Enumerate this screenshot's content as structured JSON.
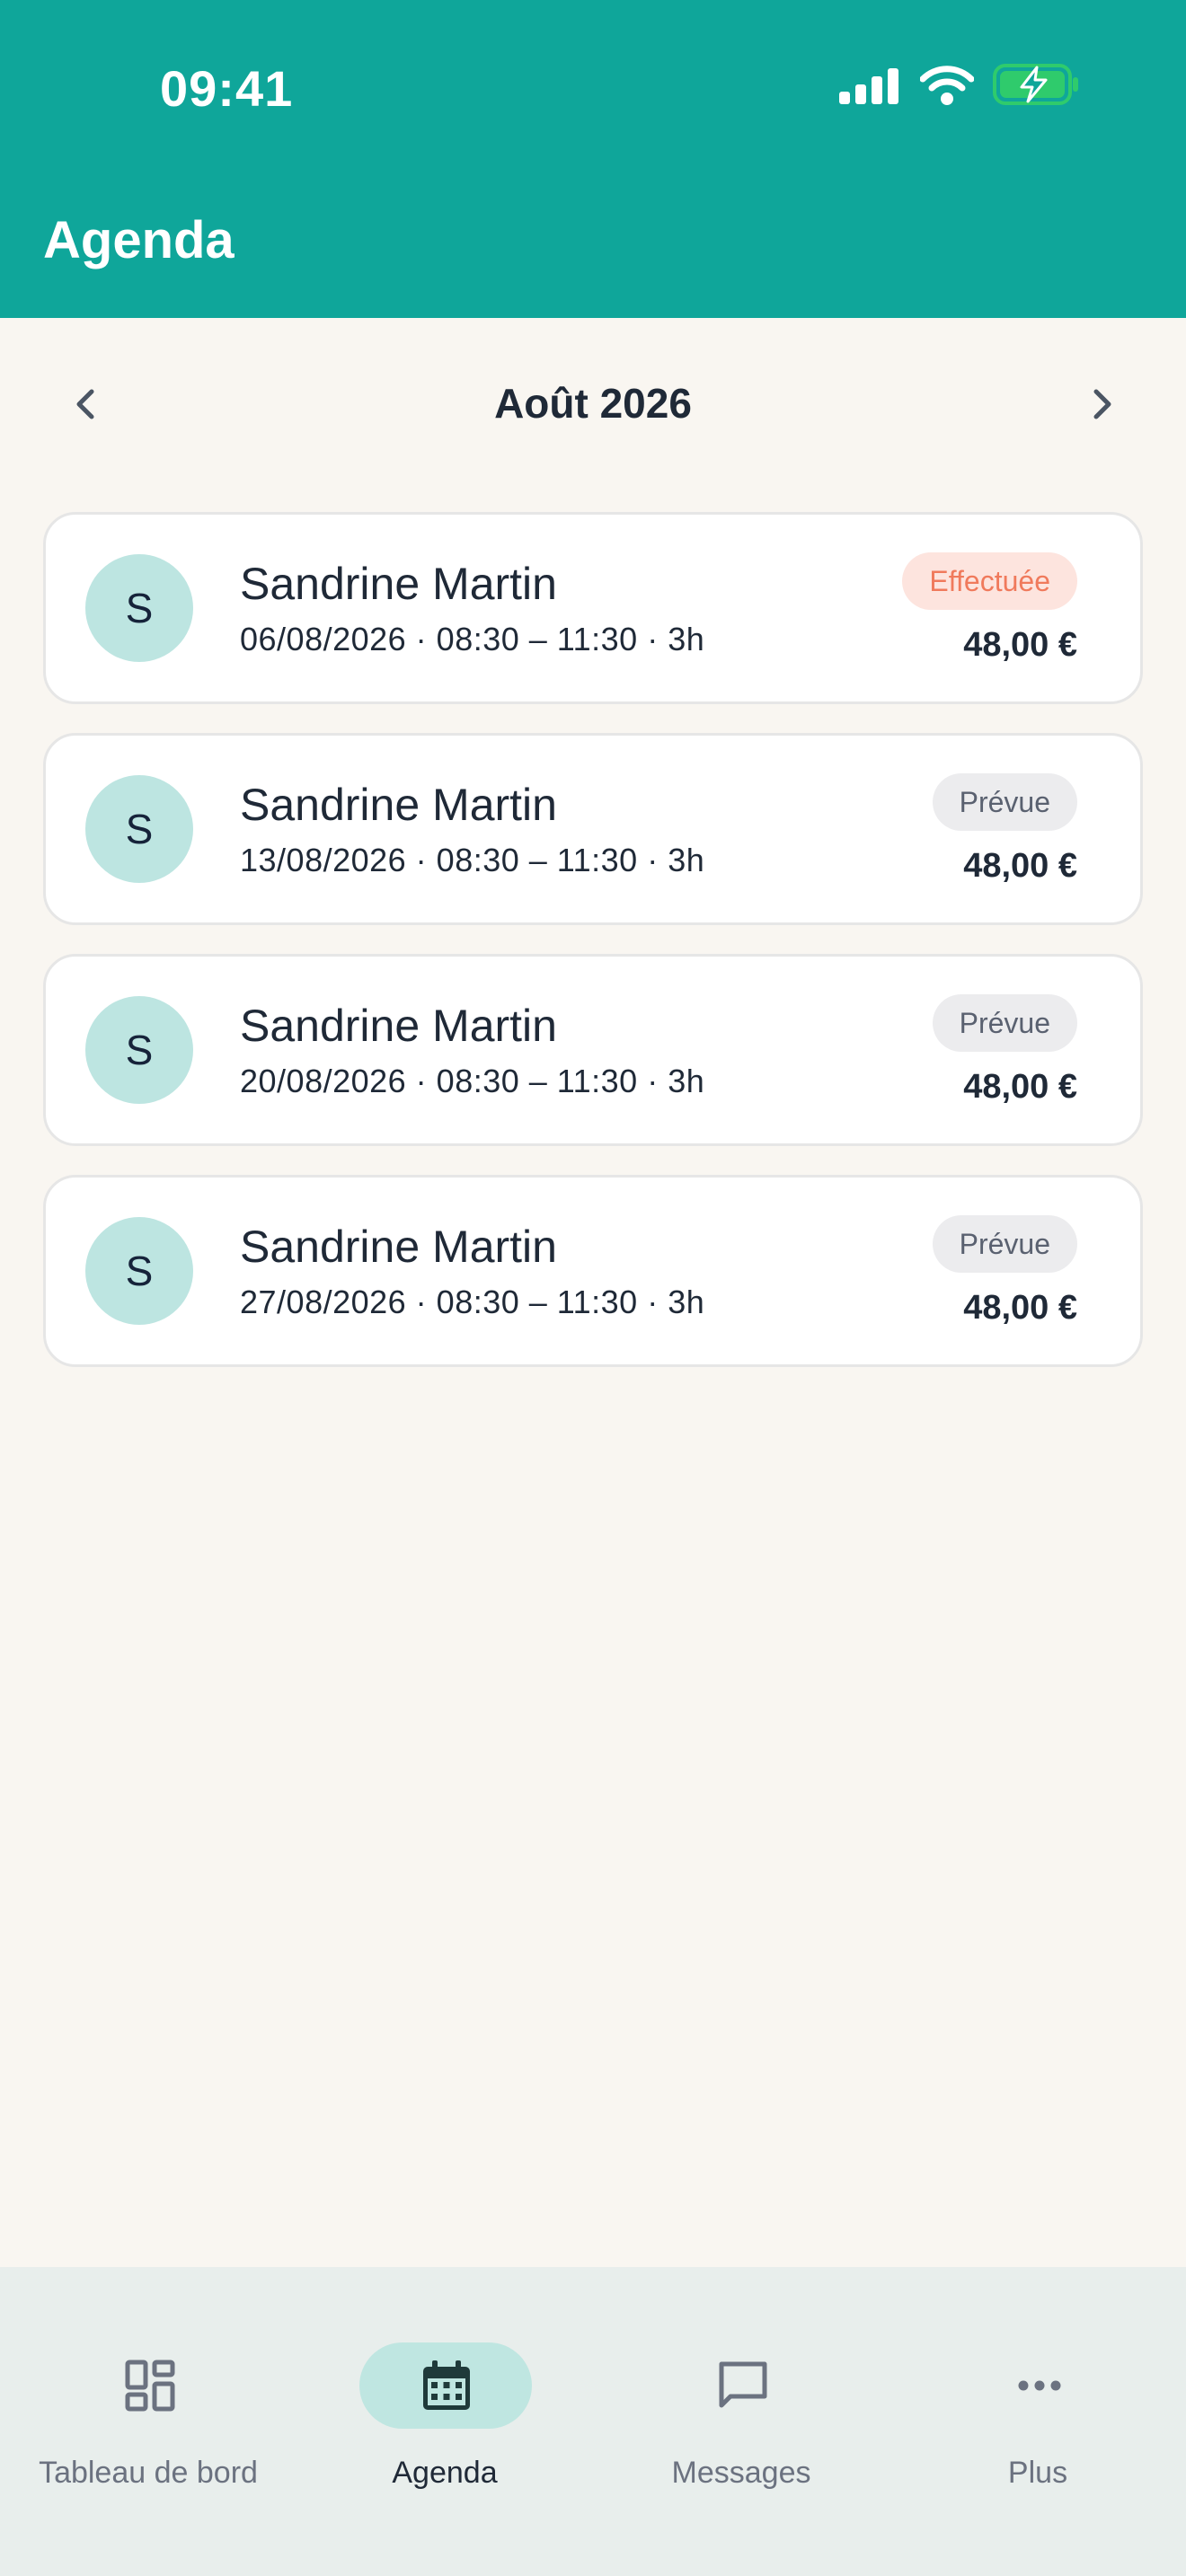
{
  "status_bar": {
    "time": "09:41"
  },
  "header": {
    "title": "Agenda"
  },
  "month_nav": {
    "label": "Août 2026"
  },
  "appointments": [
    {
      "initial": "S",
      "name": "Sandrine Martin",
      "meta": "06/08/2026 · 08:30 – 11:30 · 3h",
      "status": "Effectuée",
      "price": "48,00 €"
    },
    {
      "initial": "S",
      "name": "Sandrine Martin",
      "meta": "13/08/2026 · 08:30 – 11:30 · 3h",
      "status": "Prévue",
      "price": "48,00 €"
    },
    {
      "initial": "S",
      "name": "Sandrine Martin",
      "meta": "20/08/2026 · 08:30 – 11:30 · 3h",
      "status": "Prévue",
      "price": "48,00 €"
    },
    {
      "initial": "S",
      "name": "Sandrine Martin",
      "meta": "27/08/2026 · 08:30 – 11:30 · 3h",
      "status": "Prévue",
      "price": "48,00 €"
    }
  ],
  "bottom_nav": {
    "items": [
      {
        "label": "Tableau de bord",
        "icon": "dashboard-icon"
      },
      {
        "label": "Agenda",
        "icon": "calendar-icon",
        "active": true
      },
      {
        "label": "Messages",
        "icon": "message-icon"
      },
      {
        "label": "Plus",
        "icon": "more-icon"
      }
    ]
  },
  "colors": {
    "header": "#0FA69A",
    "background": "#F9F6F1",
    "avatar": "#BDE5E1",
    "badge_done_bg": "#FDE4DE",
    "badge_done_text": "#F07A5C",
    "badge_planned_bg": "#ECECEE",
    "active_pill": "#BFE6E1"
  }
}
